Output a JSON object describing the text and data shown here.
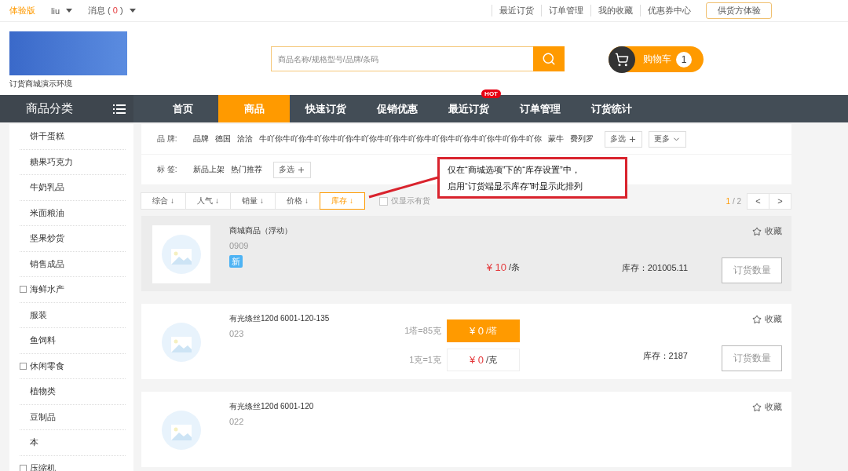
{
  "top_bar": {
    "edition": "体验版",
    "user": "liu",
    "messages": {
      "label": "消息 (",
      "count": "0",
      "suffix": ")"
    },
    "links": [
      "最近订货",
      "订单管理",
      "我的收藏",
      "优惠券中心"
    ],
    "supplier_button": "供货方体验"
  },
  "header": {
    "store_name": "订货商城演示环境",
    "search": {
      "placeholder": "商品名称/规格型号/品牌/条码"
    },
    "cart": {
      "label": "购物车",
      "count": "1"
    }
  },
  "nav": {
    "category_title": "商品分类",
    "items": [
      {
        "label": "首页",
        "selected": false
      },
      {
        "label": "商品",
        "selected": true
      },
      {
        "label": "快速订货",
        "selected": false
      },
      {
        "label": "促销优惠",
        "selected": false
      },
      {
        "label": "最近订货",
        "selected": false,
        "badge": "HOT"
      },
      {
        "label": "订单管理",
        "selected": false
      },
      {
        "label": "订货统计",
        "selected": false
      }
    ]
  },
  "sidebar": {
    "items": [
      {
        "label": "饼干蛋糕",
        "expandable": false
      },
      {
        "label": "糖果巧克力",
        "expandable": false
      },
      {
        "label": "牛奶乳品",
        "expandable": false
      },
      {
        "label": "米面粮油",
        "expandable": false
      },
      {
        "label": "坚果炒货",
        "expandable": false
      },
      {
        "label": "销售成品",
        "expandable": false
      },
      {
        "label": "海鲜水产",
        "expandable": true
      },
      {
        "label": "服装",
        "expandable": false
      },
      {
        "label": "鱼饲料",
        "expandable": false
      },
      {
        "label": "休闲零食",
        "expandable": true
      },
      {
        "label": "植物类",
        "expandable": false
      },
      {
        "label": "豆制品",
        "expandable": false
      },
      {
        "label": "本",
        "expandable": false
      },
      {
        "label": "压缩机",
        "expandable": true
      }
    ]
  },
  "filters": {
    "brand": {
      "label": "品 牌:",
      "values": [
        "品牌",
        "德国",
        "洽洽",
        "牛吖你牛吖你牛吖你牛吖你牛吖你牛吖你牛吖你牛吖你牛吖你牛吖你牛吖你牛吖你",
        "蒙牛",
        "费列罗"
      ],
      "multi": "多选",
      "more": "更多"
    },
    "tags": {
      "label": "标 签:",
      "values": [
        "新品上架",
        "热门推荐"
      ],
      "multi": "多选"
    }
  },
  "sort": {
    "items": [
      {
        "label": "综合 ↓",
        "selected": false
      },
      {
        "label": "人气 ↓",
        "selected": false
      },
      {
        "label": "销量 ↓",
        "selected": false
      },
      {
        "label": "价格 ↓",
        "selected": false
      },
      {
        "label": "库存 ↓",
        "selected": true
      }
    ],
    "in_stock_only": {
      "label": "仅显示有货",
      "checked": false
    },
    "page": {
      "current": "1",
      "total": "/ 2",
      "prev": "<",
      "next": ">"
    }
  },
  "annotation": {
    "lines": [
      "仅在“商城选项”下的“库存设置”中，",
      "启用“订货端显示库存”时显示此排列"
    ]
  },
  "products": [
    {
      "name": "商城商品（浮动）",
      "code": "0909",
      "tag": "新",
      "highlighted": true,
      "collect": "收藏",
      "stock": "库存：201005.11",
      "order_button": "订货数量",
      "prices": [
        {
          "kind": "plain",
          "price": "¥ 10",
          "unit": "/条"
        }
      ]
    },
    {
      "name": "有光绦丝120d 6001-120-135",
      "code": "023",
      "highlighted": false,
      "collect": "收藏",
      "stock": "库存：2187",
      "order_button": "订货数量",
      "prices": [
        {
          "kind": "filled",
          "note": "1塔=85克",
          "price": "¥ 0",
          "unit": "/塔"
        },
        {
          "kind": "outlined",
          "note": "1克=1克",
          "price": "¥ 0",
          "unit": "/克"
        }
      ]
    },
    {
      "name": "有光绦丝120d 6001-120",
      "code": "022",
      "highlighted": false,
      "collect": "收藏"
    }
  ]
}
